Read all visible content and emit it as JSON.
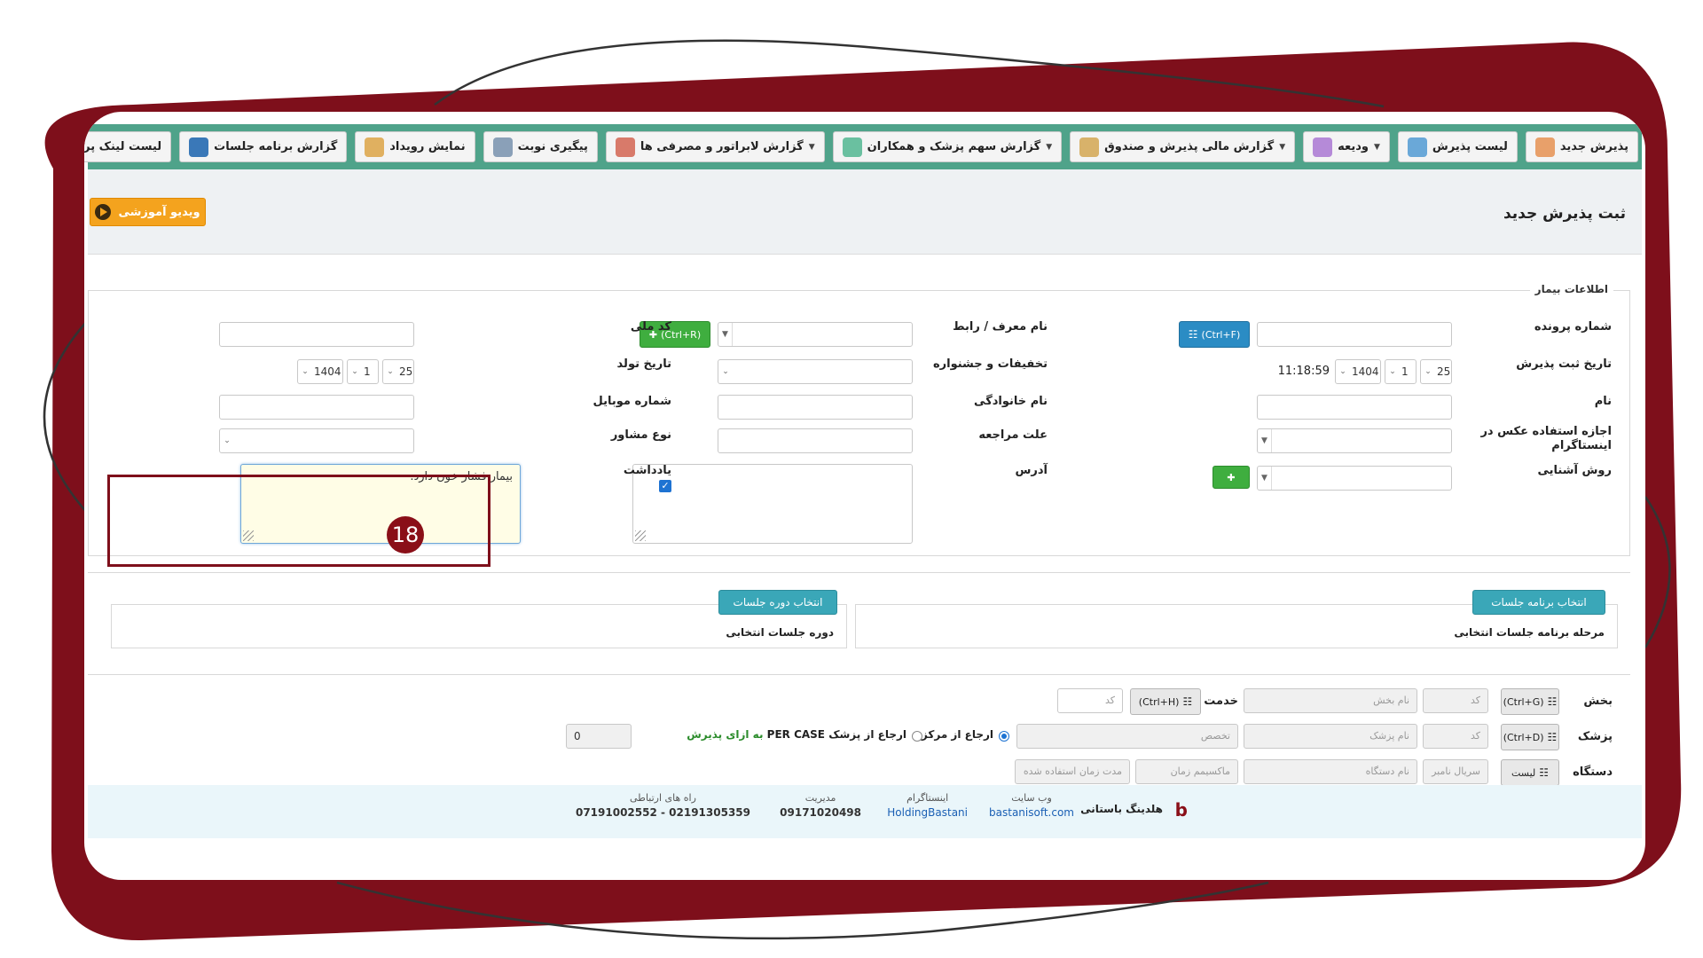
{
  "nav": [
    {
      "label": "پذیرش جدید",
      "icon": "user-icon",
      "caret": false
    },
    {
      "label": "لیست پذیرش",
      "icon": "list-icon",
      "caret": false
    },
    {
      "label": "ودیعه",
      "icon": "deposit-icon",
      "caret": true
    },
    {
      "label": "گزارش مالی پذیرش و صندوق",
      "icon": "finance-report-icon",
      "caret": true
    },
    {
      "label": "گزارش سهم پزشک و همکاران",
      "icon": "doctor-share-icon",
      "caret": true
    },
    {
      "label": "گزارش لابراتور و مصرفی ها",
      "icon": "lab-report-icon",
      "caret": true
    },
    {
      "label": "پیگیری نوبت",
      "icon": "appointment-search-icon",
      "caret": false
    },
    {
      "label": "نمایش رویداد",
      "icon": "calendar-icon",
      "caret": false
    },
    {
      "label": "گزارش برنامه جلسات",
      "icon": "sessions-report-icon",
      "caret": false
    },
    {
      "label": "لیست لینک پرداخت تایید نشده",
      "icon": "payment-link-icon",
      "caret": false
    }
  ],
  "page_title": "ثبت پذیرش جدید",
  "video_button": "ویدیو آموزشی",
  "patient": {
    "legend": "اطلاعات بیمار",
    "file_number_label": "شماره پرونده",
    "file_number_shortcut": "(Ctrl+F)",
    "referrer_label": "نام معرف / رابط",
    "referrer_shortcut": "(Ctrl+R)",
    "national_code_label": "کد ملی",
    "reg_date_label": "تاریخ ثبت پذیرش",
    "reg_day": "25",
    "reg_month": "1",
    "reg_year": "1404",
    "reg_time": "11:18:59",
    "discounts_label": "تخفیفات و جشنواره",
    "birth_date_label": "تاریخ تولد",
    "birth_day": "25",
    "birth_month": "1",
    "birth_year": "1404",
    "name_label": "نام",
    "family_label": "نام خانوادگی",
    "mobile_label": "شماره موبایل",
    "photo_permission_label": "اجازه استفاده عکس در اینستاگرام",
    "visit_reason_label": "علت مراجعه",
    "consultant_type_label": "نوع مشاور",
    "acquaintance_label": "روش آشنایی",
    "address_label": "آدرس",
    "note_label": "یادداشت",
    "note_value": "بیمار فشار خون دارد.",
    "step_badge": "18"
  },
  "sessions": {
    "select_program_button": "انتخاب برنامه جلسات",
    "program_stage_label": "مرحله برنامه جلسات انتخابی",
    "select_course_button": "انتخاب دوره جلسات",
    "course_label": "دوره جلسات انتخابی"
  },
  "services": {
    "department_label": "بخش",
    "department_shortcut": "(Ctrl+G)",
    "code_placeholder": "کد",
    "department_name_placeholder": "نام بخش",
    "service_label": "خدمت",
    "service_shortcut": "(Ctrl+H)",
    "service_code_placeholder": "کد",
    "doctor_label": "پزشک",
    "doctor_shortcut": "(Ctrl+D)",
    "doctor_code_placeholder": "کد",
    "doctor_name_placeholder": "نام پزشک",
    "specialty_placeholder": "تخصص",
    "referral_center_label": "ارجاع از مرکز",
    "referral_doctor_label": "ارجاع از پزشک",
    "per_case_prefix": "PER CASE",
    "per_case_suffix": "به ازای پذیرش",
    "per_case_value": "0",
    "device_label": "دستگاه",
    "device_list_button": "لیست",
    "serial_placeholder": "سریال نامبر",
    "device_name_placeholder": "نام دستگاه",
    "max_time_placeholder": "ماکسیمم زمان",
    "used_time_placeholder": "مدت زمان استفاده شده"
  },
  "footer": {
    "company": "هلدینگ باستانی",
    "website_label": "وب سایت",
    "website_value": "bastanisoft.com",
    "instagram_label": "اینستاگرام",
    "instagram_value": "HoldingBastani",
    "management_label": "مدیریت",
    "management_value": "09171020498",
    "contacts_label": "راه های ارتباطی",
    "contacts_value": "07191002552 - 02191305359"
  },
  "colors": {
    "frame_red": "#8a0f18",
    "nav_green": "#4fa38a",
    "accent_blue": "#2b8cc4",
    "accent_orange": "#f4a31e",
    "accent_teal": "#3aa7b8"
  }
}
